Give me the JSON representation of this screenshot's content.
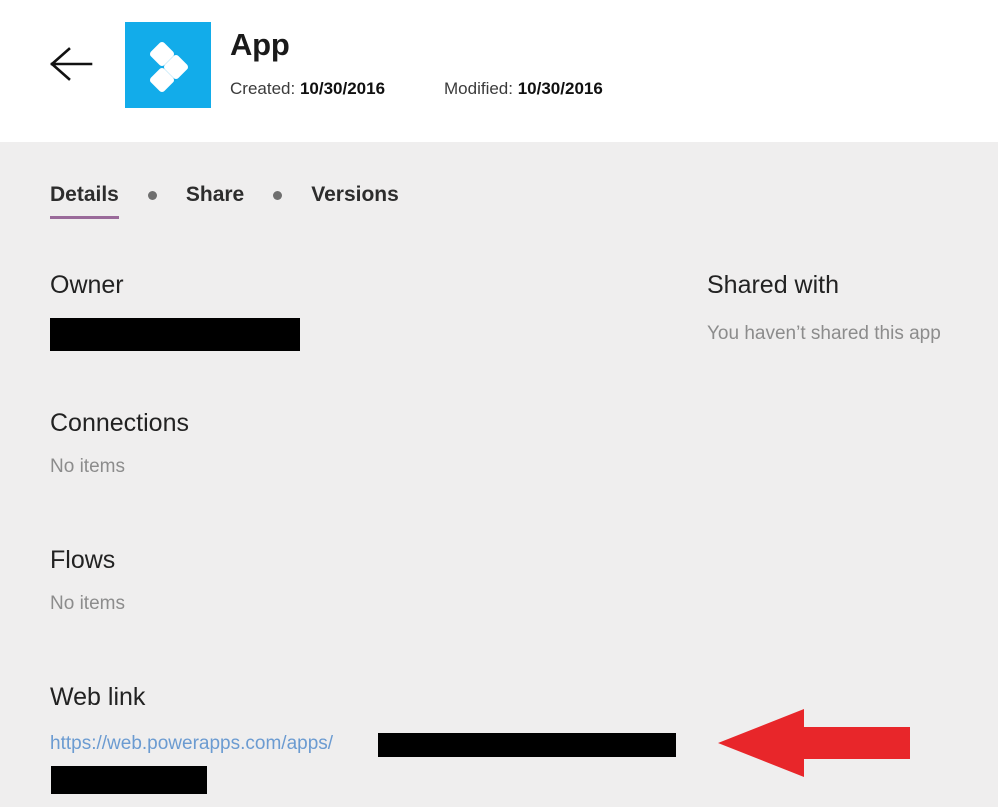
{
  "header": {
    "back_icon": "arrow-left-icon",
    "app_icon": "powerapps-logo-icon",
    "app_icon_color": "#12acea",
    "title": "App",
    "created_label": "Created:",
    "created_value": "10/30/2016",
    "modified_label": "Modified:",
    "modified_value": "10/30/2016"
  },
  "tabs": [
    {
      "label": "Details",
      "active": true
    },
    {
      "label": "Share",
      "active": false
    },
    {
      "label": "Versions",
      "active": false
    }
  ],
  "tab_active_color": "#9a6a9a",
  "left_column": {
    "owner": {
      "heading": "Owner",
      "value_redacted": true
    },
    "connections": {
      "heading": "Connections",
      "empty_text": "No items"
    },
    "flows": {
      "heading": "Flows",
      "empty_text": "No items"
    },
    "web_link": {
      "heading": "Web link",
      "url_visible_text": "https://web.powerapps.com/apps/",
      "url_color": "#6b9bd1",
      "remainder_redacted": true
    }
  },
  "right_column": {
    "shared_with": {
      "heading": "Shared with",
      "empty_text": "You haven’t shared this app"
    }
  },
  "annotation": {
    "arrow_icon": "arrow-left-annotation-icon",
    "arrow_color": "#e8262a",
    "direction": "left"
  },
  "theme": {
    "header_background": "#ffffff",
    "body_background": "#efeeee",
    "redaction_color": "#000000",
    "heading_color": "#222222",
    "muted_text_color": "#8c8c8c"
  }
}
